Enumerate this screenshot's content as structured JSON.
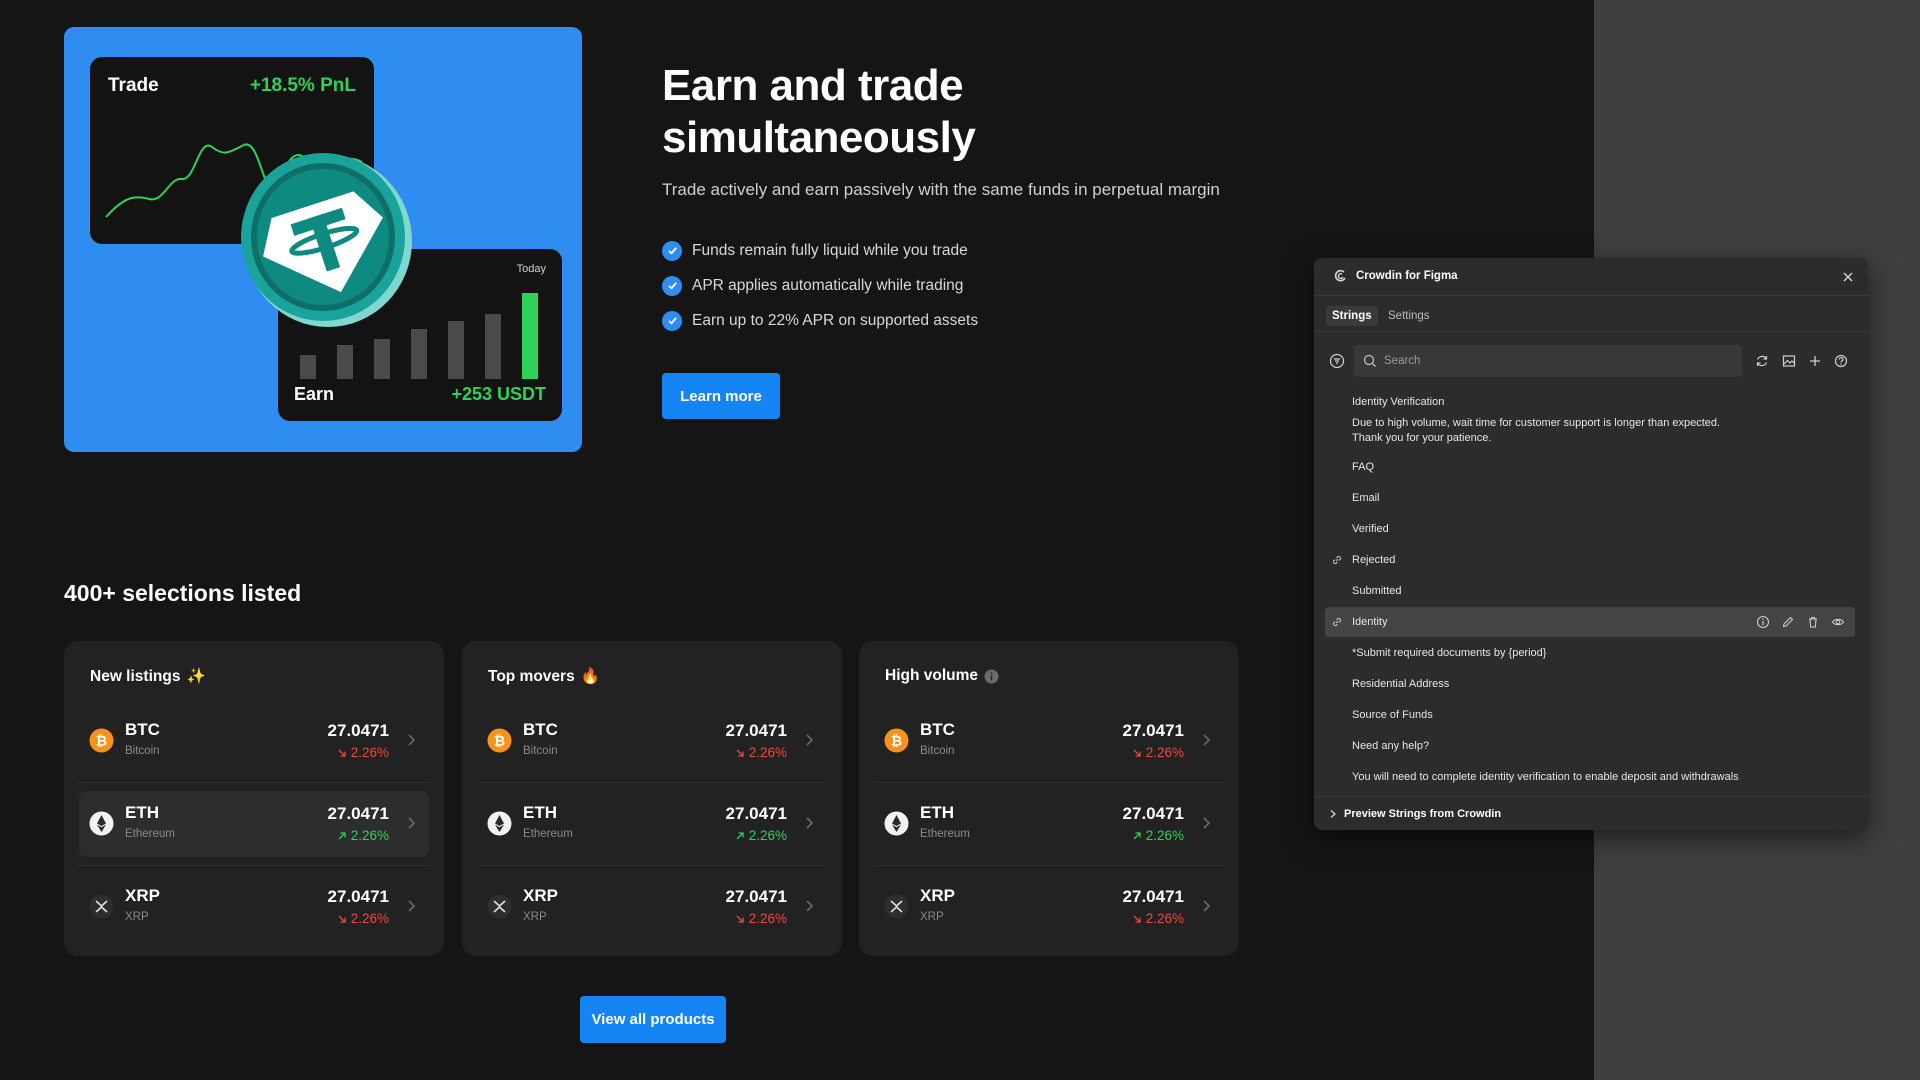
{
  "hero": {
    "trade_label": "Trade",
    "trade_pnl": "+18.5% PnL",
    "earn_label": "Earn",
    "earn_value": "+253 USDT",
    "today_label": "Today",
    "bar_levels": [
      0.25,
      0.35,
      0.42,
      0.52,
      0.6,
      0.68,
      0.9
    ],
    "title": "Earn and trade simultaneously",
    "subtitle": "Trade actively and earn passively with the same funds in perpetual margin",
    "features": [
      "Funds remain fully liquid while you trade",
      "APR applies automatically while trading",
      "Earn up to 22% APR on supported assets"
    ],
    "learn_more": "Learn more"
  },
  "section_title": "400+ selections listed",
  "cards": [
    {
      "title": "New listings",
      "title_emoji": "✨",
      "rows": [
        {
          "symbol": "BTC",
          "name": "Bitcoin",
          "price": "27.0471",
          "change": "2.26%",
          "direction": "down",
          "icon": "bitcoin-icon",
          "highlight": false
        },
        {
          "symbol": "ETH",
          "name": "Ethereum",
          "price": "27.0471",
          "change": "2.26%",
          "direction": "up",
          "icon": "ethereum-icon",
          "highlight": true
        },
        {
          "symbol": "XRP",
          "name": "XRP",
          "price": "27.0471",
          "change": "2.26%",
          "direction": "down",
          "icon": "xrp-icon",
          "highlight": false
        }
      ]
    },
    {
      "title": "Top movers",
      "title_emoji": "🔥",
      "rows": [
        {
          "symbol": "BTC",
          "name": "Bitcoin",
          "price": "27.0471",
          "change": "2.26%",
          "direction": "down",
          "icon": "bitcoin-icon",
          "highlight": false
        },
        {
          "symbol": "ETH",
          "name": "Ethereum",
          "price": "27.0471",
          "change": "2.26%",
          "direction": "up",
          "icon": "ethereum-icon",
          "highlight": false
        },
        {
          "symbol": "XRP",
          "name": "XRP",
          "price": "27.0471",
          "change": "2.26%",
          "direction": "down",
          "icon": "xrp-icon",
          "highlight": false
        }
      ]
    },
    {
      "title": "High volume",
      "title_emoji": "",
      "rows": [
        {
          "symbol": "BTC",
          "name": "Bitcoin",
          "price": "27.0471",
          "change": "2.26%",
          "direction": "down",
          "icon": "bitcoin-icon",
          "highlight": false
        },
        {
          "symbol": "ETH",
          "name": "Ethereum",
          "price": "27.0471",
          "change": "2.26%",
          "direction": "up",
          "icon": "ethereum-icon",
          "highlight": false
        },
        {
          "symbol": "XRP",
          "name": "XRP",
          "price": "27.0471",
          "change": "2.26%",
          "direction": "down",
          "icon": "xrp-icon",
          "highlight": false
        }
      ]
    }
  ],
  "view_all": "View all products",
  "crowdin": {
    "title": "Crowdin for Figma",
    "tabs": [
      {
        "label": "Strings",
        "active": true
      },
      {
        "label": "Settings",
        "active": false
      }
    ],
    "search_placeholder": "Search",
    "strings": [
      "Identity Verification",
      "Due to high volume, wait time for customer support is longer than expected.\nThank you for your patience.",
      "FAQ",
      "Email",
      "Verified",
      "Rejected",
      "Submitted",
      "Identity",
      "*Submit required documents by {period}",
      "Residential Address",
      "Source of Funds",
      "Need any help?",
      "You will need to complete identity verification to enable deposit and withdrawals"
    ],
    "selected_index": 7,
    "linked_indices": [
      5,
      7
    ],
    "footer": "Preview Strings from Crowdin"
  },
  "colors": {
    "accent": "#1585f5",
    "hero_bg": "#2f8cf0",
    "positive": "#30d158",
    "negative": "#f0483e",
    "btc": "#f7931a"
  }
}
